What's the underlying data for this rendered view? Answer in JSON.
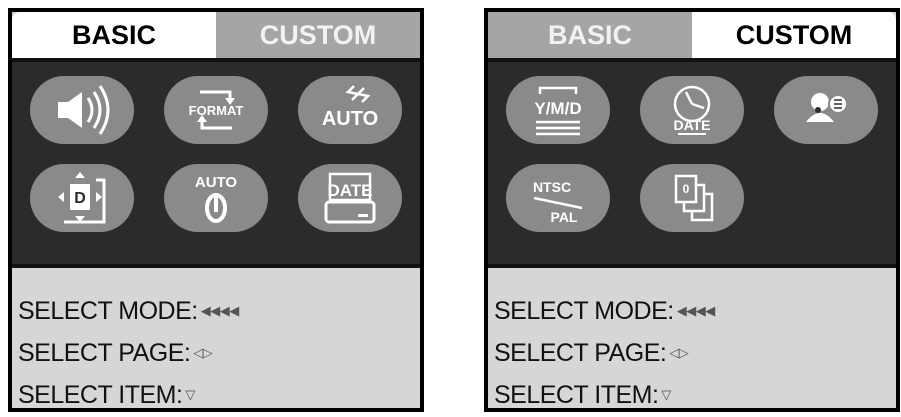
{
  "panels": [
    {
      "active_tab": "BASIC",
      "tabs": {
        "basic": "BASIC",
        "custom": "CUSTOM"
      },
      "icons": [
        {
          "name": "volume-icon"
        },
        {
          "name": "format-icon",
          "label": "FORMAT"
        },
        {
          "name": "auto-flash-icon",
          "label": "AUTO"
        },
        {
          "name": "display-position-icon",
          "label": "D"
        },
        {
          "name": "auto-power-off-icon",
          "label": "AUTO"
        },
        {
          "name": "date-imprint-icon",
          "label": "DATE"
        }
      ],
      "help": {
        "select_mode": "SELECT MODE:",
        "select_page": "SELECT PAGE:",
        "select_item": "SELECT ITEM:",
        "mode_glyph": "◀◀◀◀",
        "page_glyph": "◁▷",
        "item_glyph": "▽"
      }
    },
    {
      "active_tab": "CUSTOM",
      "tabs": {
        "basic": "BASIC",
        "custom": "CUSTOM"
      },
      "icons": [
        {
          "name": "date-format-icon",
          "label": "Y/M/D"
        },
        {
          "name": "date-time-icon",
          "label": "DATE"
        },
        {
          "name": "language-icon"
        },
        {
          "name": "video-output-icon",
          "label_top": "NTSC",
          "label_bottom": "PAL"
        },
        {
          "name": "file-number-icon",
          "label": "0"
        }
      ],
      "help": {
        "select_mode": "SELECT MODE:",
        "select_page": "SELECT PAGE:",
        "select_item": "SELECT ITEM:",
        "mode_glyph": "◀◀◀◀",
        "page_glyph": "◁▷",
        "item_glyph": "▽"
      }
    }
  ],
  "colors": {
    "screen_bg": "#2b2b2b",
    "icon_bg": "#8a8a8a",
    "inactive_tab": "#a5a5a5",
    "panel_bg": "#d6d6d6"
  }
}
